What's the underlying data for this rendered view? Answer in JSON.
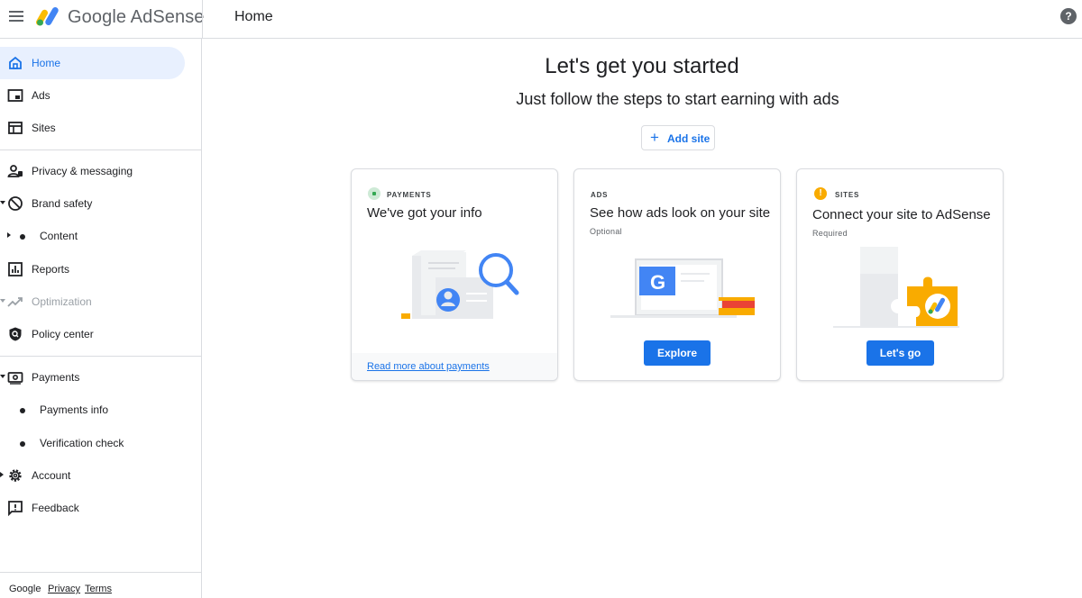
{
  "header": {
    "brand_google": "Google",
    "brand_product": "AdSense",
    "page_title": "Home",
    "help_glyph": "?"
  },
  "sidebar": {
    "items": [
      {
        "label": "Home",
        "icon": "home-icon"
      },
      {
        "label": "Ads",
        "icon": "ads-icon"
      },
      {
        "label": "Sites",
        "icon": "sites-icon"
      },
      {
        "label": "Privacy & messaging",
        "icon": "privacy-icon"
      },
      {
        "label": "Brand safety",
        "icon": "block-icon"
      },
      {
        "label": "Content",
        "icon": "dot-icon"
      },
      {
        "label": "Reports",
        "icon": "reports-icon"
      },
      {
        "label": "Optimization",
        "icon": "trending-icon"
      },
      {
        "label": "Policy center",
        "icon": "shield-icon"
      },
      {
        "label": "Payments",
        "icon": "payments-icon"
      },
      {
        "label": "Payments info",
        "icon": "dot-icon"
      },
      {
        "label": "Verification check",
        "icon": "dot-icon"
      },
      {
        "label": "Account",
        "icon": "gear-icon"
      },
      {
        "label": "Feedback",
        "icon": "feedback-icon"
      }
    ],
    "footer": {
      "google": "Google",
      "privacy": "Privacy",
      "terms": "Terms"
    }
  },
  "main": {
    "title": "Let's get you started",
    "subtitle": "Just follow the steps to start earning with ads",
    "add_site_label": "Add site",
    "cards": [
      {
        "tag": "PAYMENTS",
        "title": "We've got your info",
        "footer_link": "Read more about payments",
        "status_color": "#34a853"
      },
      {
        "tag": "ADS",
        "title": "See how ads look on your site",
        "note": "Optional",
        "button": "Explore"
      },
      {
        "tag": "SITES",
        "title": "Connect your site to AdSense",
        "note": "Required",
        "button": "Let's go",
        "status_color": "#f9ab00",
        "status_glyph": "!"
      }
    ]
  },
  "colors": {
    "accent": "#1a73e8",
    "active_bg": "#e8f0fe",
    "divider": "#dadce0"
  }
}
